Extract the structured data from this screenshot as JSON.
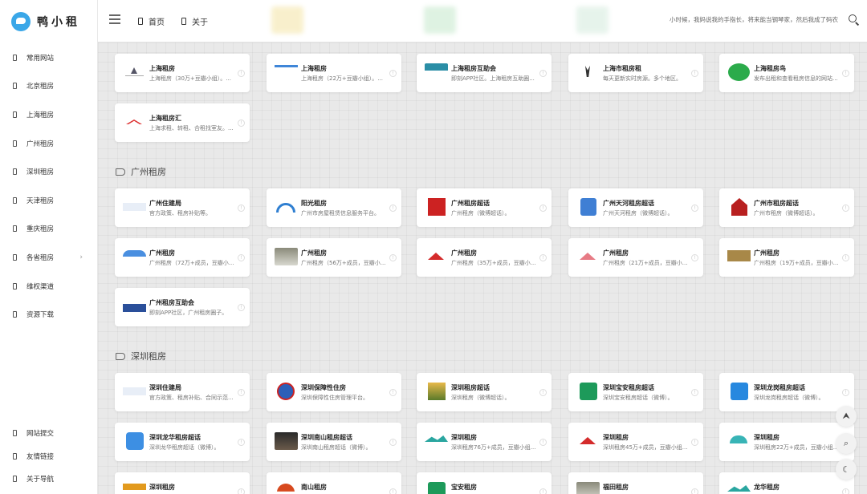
{
  "brand": {
    "title": "鸭小租"
  },
  "sidebar": {
    "items": [
      {
        "label": "常用网站"
      },
      {
        "label": "北京租房"
      },
      {
        "label": "上海租房"
      },
      {
        "label": "广州租房"
      },
      {
        "label": "深圳租房"
      },
      {
        "label": "天津租房"
      },
      {
        "label": "重庆租房"
      },
      {
        "label": "各省租房",
        "chevron": "›"
      },
      {
        "label": "维权渠道"
      },
      {
        "label": "资源下载"
      }
    ],
    "bottom_items": [
      {
        "label": "网站提交"
      },
      {
        "label": "友情链接"
      },
      {
        "label": "关于导航"
      }
    ]
  },
  "header": {
    "links": [
      {
        "label": "首页"
      },
      {
        "label": "关于"
      }
    ],
    "notice": "小时候，我妈说我的手指长，将来能当钢琴家，然后我成了码农"
  },
  "sections": [
    {
      "title": "",
      "cards": [
        {
          "name": "上海租房",
          "desc": "上海租房（30万+豆瓣小组）。...",
          "thumb": "logo-tree"
        },
        {
          "name": "上海租房",
          "desc": "上海租房（22万+豆瓣小组）。...",
          "thumb": "logo-blue-bar"
        },
        {
          "name": "上海租房互助会",
          "desc": "即刻APP社区。上海租房互助圈...",
          "thumb": "logo-teal-banner"
        },
        {
          "name": "上海市租房租",
          "desc": "每天更新实时房源。多个地区。",
          "thumb": "logo-deer"
        },
        {
          "name": "上海租房鸟",
          "desc": "发布出租和查看租房信息的网站...",
          "thumb": "logo-green-circle"
        },
        {
          "name": "上海租房汇",
          "desc": "上海求租、转租、合租找室友。...",
          "thumb": "logo-roof"
        }
      ]
    },
    {
      "title": "广州租房",
      "cards": [
        {
          "name": "广州住建局",
          "desc": "官方政策、租房补贴等。",
          "thumb": "logo-gov-strip"
        },
        {
          "name": "阳光租房",
          "desc": "广州市房屋租赁信息服务平台。",
          "thumb": "logo-sun-arc"
        },
        {
          "name": "广州租房超话",
          "desc": "广州租房（微博超话）。",
          "thumb": "logo-red-seal"
        },
        {
          "name": "广州天河租房超话",
          "desc": "广州天河租房（微博超话）。",
          "thumb": "logo-blue-house"
        },
        {
          "name": "广州市租房超话",
          "desc": "广州市租房（微博超话）。",
          "thumb": "logo-red-house"
        },
        {
          "name": "广州租房",
          "desc": "广州租房（72万+成员，豆瓣小...",
          "thumb": "logo-blue-roof"
        },
        {
          "name": "广州租房",
          "desc": "广州租房（56万+成员，豆瓣小...",
          "thumb": "logo-photo"
        },
        {
          "name": "广州租房",
          "desc": "广州租房（35万+成员，豆瓣小...",
          "thumb": "logo-red-roof"
        },
        {
          "name": "广州租房",
          "desc": "广州租房（21万+成员，豆瓣小...",
          "thumb": "logo-pink-roof"
        },
        {
          "name": "广州租房",
          "desc": "广州租房（19万+成员，豆瓣小...",
          "thumb": "logo-brown-badge"
        },
        {
          "name": "广州租房互助会",
          "desc": "即刻APP社区，广州租房圈子。",
          "thumb": "logo-city-banner"
        }
      ]
    },
    {
      "title": "深圳租房",
      "cards": [
        {
          "name": "深圳住建局",
          "desc": "官方政策、租房补贴、合同示范...",
          "thumb": "logo-gov-strip"
        },
        {
          "name": "深圳保障性住房",
          "desc": "深圳保障性住房管理平台。",
          "thumb": "logo-shield"
        },
        {
          "name": "深圳租房超话",
          "desc": "深圳租房（微博超话）。",
          "thumb": "logo-house-photo"
        },
        {
          "name": "深圳宝安租房超话",
          "desc": "深圳宝安租房超话（微博）。",
          "thumb": "logo-green-home"
        },
        {
          "name": "深圳龙岗租房超话",
          "desc": "深圳龙岗租房超话（微博）。",
          "thumb": "logo-blue-home"
        },
        {
          "name": "深圳龙华租房超话",
          "desc": "深圳龙华租房超话（微博）。",
          "thumb": "logo-blue-zu"
        },
        {
          "name": "深圳南山租房超话",
          "desc": "深圳南山租房超话（微博）。",
          "thumb": "logo-dark-photo"
        },
        {
          "name": "深圳租房",
          "desc": "深圳租房76万+成员，豆瓣小组...",
          "thumb": "logo-mountain"
        },
        {
          "name": "深圳租房",
          "desc": "深圳租房45万+成员，豆瓣小组...",
          "thumb": "logo-red-roof"
        },
        {
          "name": "深圳租房",
          "desc": "深圳租房22万+成员，豆瓣小组...",
          "thumb": "logo-teal-roof"
        },
        {
          "name": "深圳租房",
          "desc": "",
          "thumb": "logo-orange-bar"
        },
        {
          "name": "南山租房",
          "desc": "",
          "thumb": "logo-orange-arc"
        },
        {
          "name": "宝安租房",
          "desc": "",
          "thumb": "logo-green-home"
        },
        {
          "name": "福田租房",
          "desc": "",
          "thumb": "logo-photo"
        },
        {
          "name": "龙华租房",
          "desc": "",
          "thumb": "logo-mountain"
        }
      ]
    }
  ],
  "float_buttons": [
    {
      "icon": "arrow-up-icon",
      "glyph": "⮝"
    },
    {
      "icon": "search-icon",
      "glyph": "⌕"
    },
    {
      "icon": "moon-icon",
      "glyph": "☾"
    }
  ],
  "colors": {
    "accent": "#3aa7e8",
    "background": "#e9e9e9",
    "card": "#ffffff"
  }
}
